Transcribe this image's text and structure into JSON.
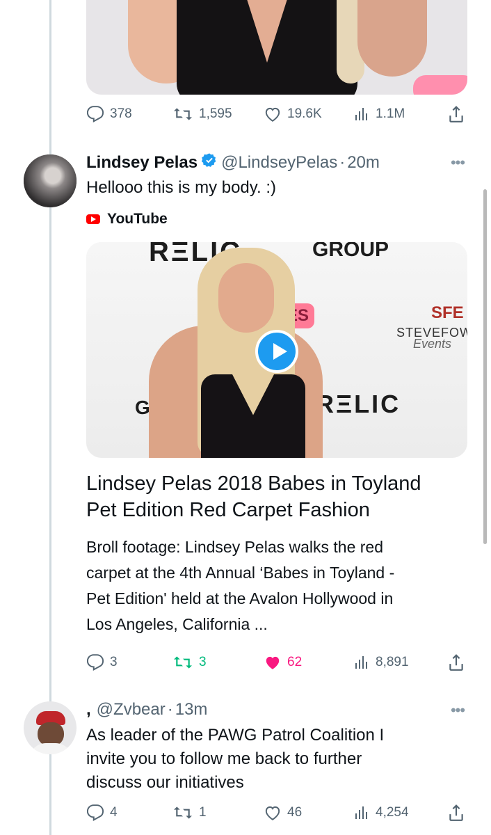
{
  "colors": {
    "accent": "#1d9bf0",
    "like_active": "#f91880",
    "retweet_active": "#00ba7c",
    "muted": "#536471",
    "youtube_red": "#ff0000"
  },
  "tweets": [
    {
      "stats": {
        "replies": "378",
        "retweets": "1,595",
        "likes": "19.6K",
        "views": "1.1M"
      }
    },
    {
      "name": "Lindsey Pelas",
      "verified": true,
      "handle": "@LindseyPelas",
      "time": "20m",
      "text": "Hellooo this is my body. :)",
      "card": {
        "source": "YouTube",
        "thumb_text": {
          "relic_top": "RΞLIC",
          "group": "GROUP",
          "badge": "ES",
          "sfe": "SFE",
          "stevefowl": "STEVEFOWL",
          "events": "Events",
          "relic_bottom": "RΞLIC",
          "gro": "GRO"
        },
        "title_line1": "Lindsey Pelas 2018 Babes in Toyland",
        "title_line2": "Pet Edition Red Carpet Fashion",
        "desc_line1": "Broll footage: Lindsey Pelas walks the red",
        "desc_line2": "carpet at the 4th Annual ‘Babes in Toyland -",
        "desc_line3": "Pet Edition' held at the Avalon Hollywood in",
        "desc_line4": "Los Angeles, California ..."
      },
      "stats": {
        "replies": "3",
        "retweets": "3",
        "likes": "62",
        "views": "8,891"
      }
    },
    {
      "name": ",",
      "handle": "@Zvbear",
      "time": "13m",
      "text_line1": "As leader of the PAWG Patrol Coalition I",
      "text_line2": "invite you to follow me back to further",
      "text_line3": "discuss our initiatives",
      "stats": {
        "replies": "4",
        "retweets": "1",
        "likes": "46",
        "views": "4,254"
      }
    }
  ],
  "icons": {
    "reply": "reply-icon",
    "retweet": "retweet-icon",
    "like": "heart-icon",
    "views": "views-icon",
    "share": "share-icon",
    "more": "more-icon",
    "verified": "verified-badge-icon",
    "play": "play-icon",
    "youtube": "youtube-icon"
  },
  "more_label": "•••",
  "separator": "·"
}
